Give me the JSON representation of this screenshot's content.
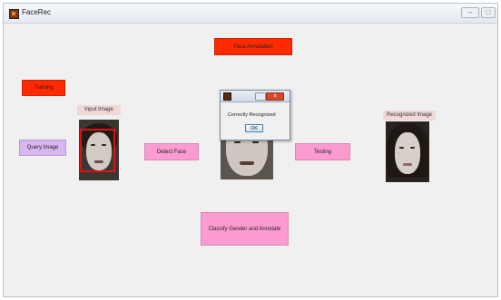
{
  "window": {
    "title": "FaceRec"
  },
  "buttons": {
    "face_annotation": "Face Annotation",
    "training": "Training",
    "query_image": "Query Image",
    "detect_face": "Detect Face",
    "testing": "Testing",
    "classify": "Classify Gender and Annotate"
  },
  "labels": {
    "input_image": "Input Image",
    "recognized_image": "Recognized Image"
  },
  "dialog": {
    "message": "Correctly Recognized",
    "ok_label": "OK",
    "close_glyph": "x"
  },
  "colors": {
    "red_button": "#ff2a00",
    "pink_button": "#fb9bd2",
    "lavender_button": "#d8b7f1",
    "label_bg": "#f0d8d8",
    "detect_box": "#e01010"
  }
}
